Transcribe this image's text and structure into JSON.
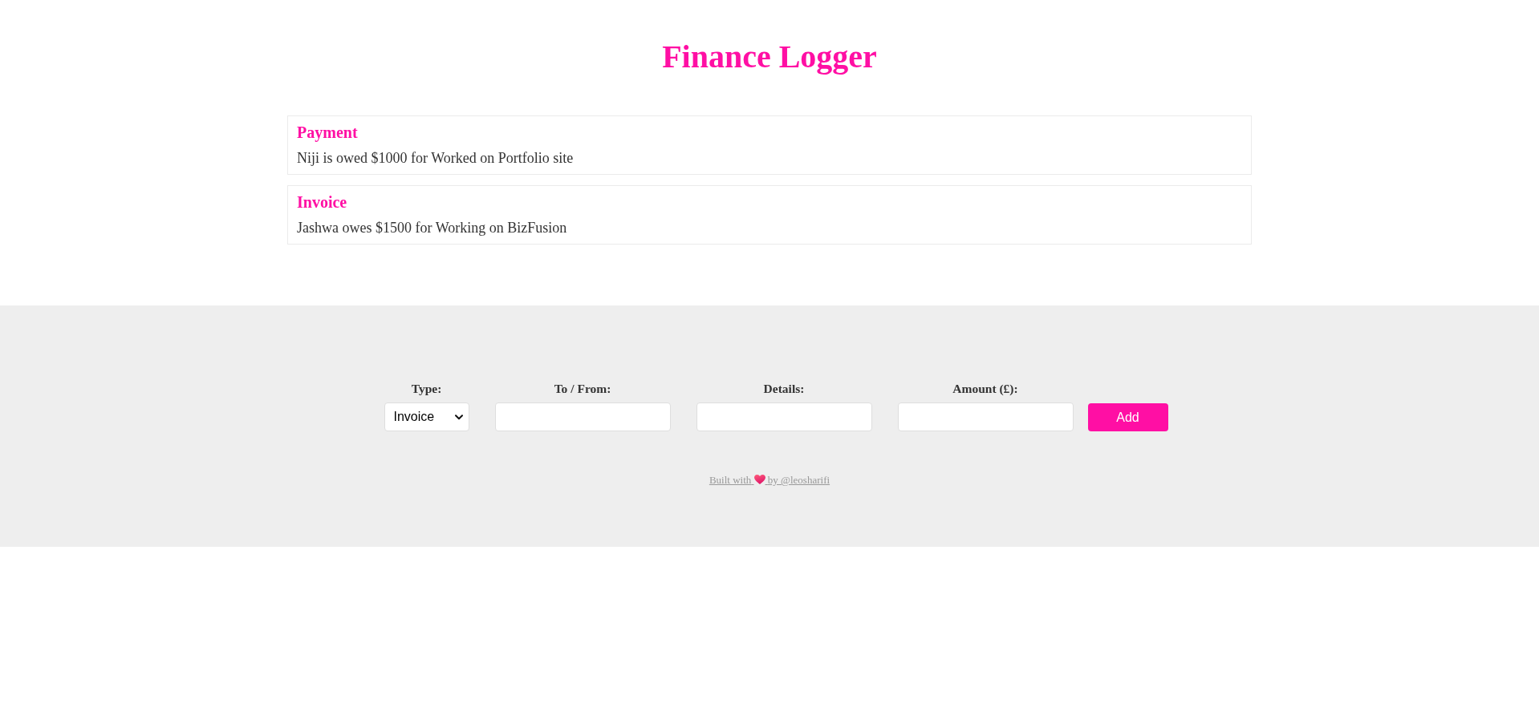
{
  "header": {
    "title": "Finance Logger"
  },
  "entries": [
    {
      "type_label": "Payment",
      "text": "Niji is owed $1000 for Worked on Portfolio site"
    },
    {
      "type_label": "Invoice",
      "text": "Jashwa owes $1500 for Working on BizFusion"
    }
  ],
  "form": {
    "fields": [
      {
        "kind": "select",
        "label": "Type:",
        "value": "Invoice"
      },
      {
        "kind": "input",
        "label": "To / From:"
      },
      {
        "kind": "input",
        "label": "Details:"
      },
      {
        "kind": "input",
        "label": "Amount (£):"
      }
    ],
    "submit": "Add"
  },
  "footer": {
    "link_before": "Built with",
    "link_after": "by @leosharifi"
  }
}
